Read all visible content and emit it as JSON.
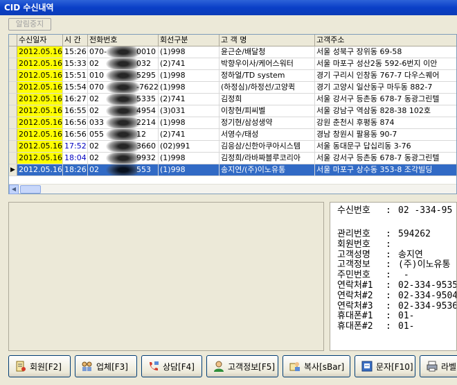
{
  "window": {
    "title": "CID 수신내역"
  },
  "alarm_stop_label": "알림중지",
  "grid": {
    "columns": [
      "수신일자",
      "시 간",
      "전화번호",
      "회선구분",
      "고 객 명",
      "고객주소"
    ],
    "rows": [
      {
        "date": "2012.05.16",
        "time": "15:26",
        "phone": "070-",
        "phone_tail": "0010",
        "line": "(1)998",
        "name": "윤근순/배달청",
        "address": "서울 성북구 장위동 69-58"
      },
      {
        "date": "2012.05.16",
        "time": "15:33",
        "phone": "02",
        "phone_tail": "032",
        "line": "(2)741",
        "name": "박향우이사/케어스워터",
        "address": "서울 마포구 성산2동 592-6번지 이안"
      },
      {
        "date": "2012.05.16",
        "time": "15:51",
        "phone": "010",
        "phone_tail": "5295",
        "line": "(1)998",
        "name": "정하얼/TD system",
        "address": "경기 구리시 인창동 767-7 다우스퀘어"
      },
      {
        "date": "2012.05.16",
        "time": "15:54",
        "phone": "070",
        "phone_tail": "-7622",
        "line": "(1)998",
        "name": "(하정심)/하정선/고양퀵",
        "address": "경기 고양시 일산동구 마두동 882-7"
      },
      {
        "date": "2012.05.16",
        "time": "16:27",
        "phone": "02",
        "phone_tail": "5335",
        "line": "(2)741",
        "name": "김정희",
        "address": "서울 강서구 등촌동 678-7 동광그린텔"
      },
      {
        "date": "2012.05.16",
        "time": "16:55",
        "phone": "02",
        "phone_tail": "4954",
        "line": "(3)031",
        "name": "이창현/피씨벨",
        "address": "서울 강남구 역삼동 828-38 102호"
      },
      {
        "date": "2012.05.16",
        "time": "16:56",
        "phone": "033",
        "phone_tail": "2214",
        "line": "(1)998",
        "name": "정기현/삼성생약",
        "address": "강원 춘천시 후평동 874"
      },
      {
        "date": "2012.05.16",
        "time": "16:56",
        "phone": "055",
        "phone_tail": "12",
        "line": "(2)741",
        "name": "서영수/태성",
        "address": "경남 창원시 팔용동  90-7"
      },
      {
        "date": "2012.05.16",
        "time": "17:52",
        "phone": "02",
        "phone_tail": "3660",
        "line": "(02)991",
        "name": "김응삼/신한아쿠아시스템",
        "address": "서울 동대문구 답십리동 3-76"
      },
      {
        "date": "2012.05.16",
        "time": "18:04",
        "phone": "02",
        "phone_tail": "9932",
        "line": "(1)998",
        "name": "김정희/라바짜블루코리아",
        "address": "서울 강서구 등촌동 678-7 동광그린텔"
      },
      {
        "date": "2012.05.16",
        "time": "18:26",
        "phone": "02",
        "phone_tail": "553",
        "line": "(1)998",
        "name": "송지연/(주)이노유통",
        "address": "서울 마포구 상수동 353-8 조각빌딩"
      }
    ]
  },
  "detail": {
    "rows": [
      {
        "label": "수신번호",
        "sep": ":",
        "value": "02   -334-95"
      },
      {
        "label": "",
        "sep": "",
        "value": ""
      },
      {
        "label": "관리번호",
        "sep": ":",
        "value": "594262"
      },
      {
        "label": "회원번호",
        "sep": ":",
        "value": ""
      },
      {
        "label": "고객성명",
        "sep": ":",
        "value": "송지연"
      },
      {
        "label": "고객정보",
        "sep": ":",
        "value": "(주)이노유통"
      },
      {
        "label": "주민번호",
        "sep": ":",
        "value": "     -"
      },
      {
        "label": "연락처#1",
        "sep": ":",
        "value": "02-334-9535"
      },
      {
        "label": "연락처#2",
        "sep": ":",
        "value": "02-334-9504"
      },
      {
        "label": "연락처#3",
        "sep": ":",
        "value": "02-334-9536"
      },
      {
        "label": "휴대폰#1",
        "sep": ":",
        "value": "01-"
      },
      {
        "label": "휴대폰#2",
        "sep": ":",
        "value": "01-"
      }
    ]
  },
  "toolbar": {
    "member": "회원[F2]",
    "company": "업체[F3]",
    "consult": "상담[F4]",
    "customer_info": "고객정보[F5]",
    "copy": "복사[sBar]",
    "sms": "문자[F10]",
    "label": "라벨"
  },
  "colors": {
    "title_bar": "#0a3fc7",
    "date_highlight": "#ffff00",
    "selection": "#316ac5"
  }
}
